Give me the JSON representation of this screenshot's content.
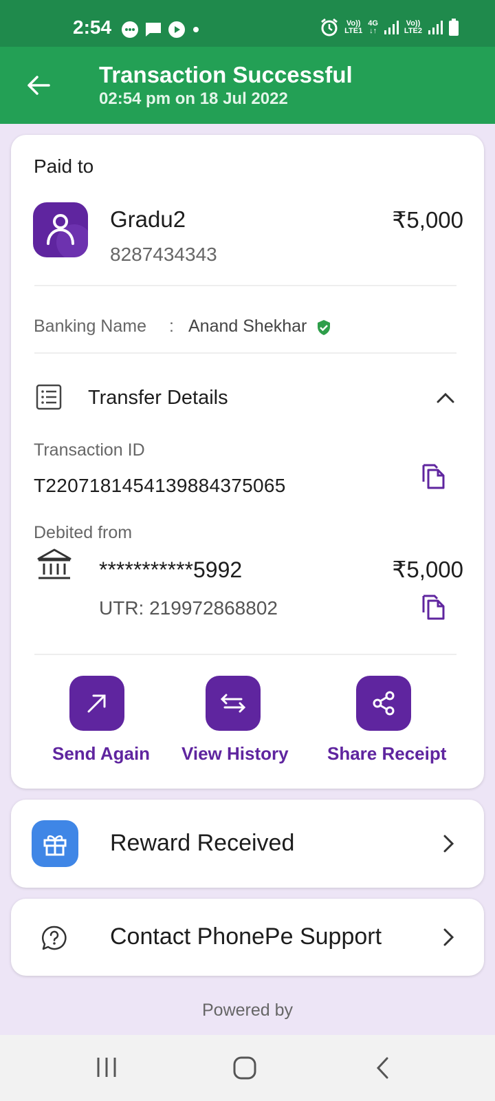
{
  "status_bar": {
    "time": "2:54",
    "sim1_label_top": "Vo))",
    "sim1_label_bottom": "LTE1",
    "network_top": "4G",
    "network_bottom": "↓↑",
    "sim2_label_top": "Vo))",
    "sim2_label_bottom": "LTE2"
  },
  "header": {
    "title": "Transaction Successful",
    "subtitle": "02:54 pm on 18 Jul 2022"
  },
  "payment": {
    "paid_to_label": "Paid to",
    "payee_name": "Gradu2",
    "payee_phone": "8287434343",
    "amount": "₹5,000",
    "banking_name_label": "Banking Name",
    "banking_name_separator": ":",
    "banking_name_value": "Anand Shekhar"
  },
  "transfer_details": {
    "title": "Transfer Details",
    "transaction_id_label": "Transaction ID",
    "transaction_id": "T2207181454139884375065",
    "debited_from_label": "Debited from",
    "account_masked": "***********5992",
    "debit_amount": "₹5,000",
    "utr": "UTR: 219972868802"
  },
  "actions": [
    {
      "label": "Send Again",
      "icon": "arrow-up-right-icon"
    },
    {
      "label": "View History",
      "icon": "swap-arrows-icon"
    },
    {
      "label": "Share Receipt",
      "icon": "share-icon"
    }
  ],
  "reward": {
    "label": "Reward Received",
    "icon": "gift-icon"
  },
  "support": {
    "label": "Contact PhonePe Support",
    "icon": "help-chat-icon"
  },
  "footer": {
    "powered_by": "Powered by"
  },
  "colors": {
    "status_bar": "#1f8a4c",
    "header": "#23a055",
    "brand_purple": "#5f259f",
    "background": "#ede5f6",
    "reward_blue": "#3f86e6",
    "verified_green": "#2e9e4a"
  }
}
